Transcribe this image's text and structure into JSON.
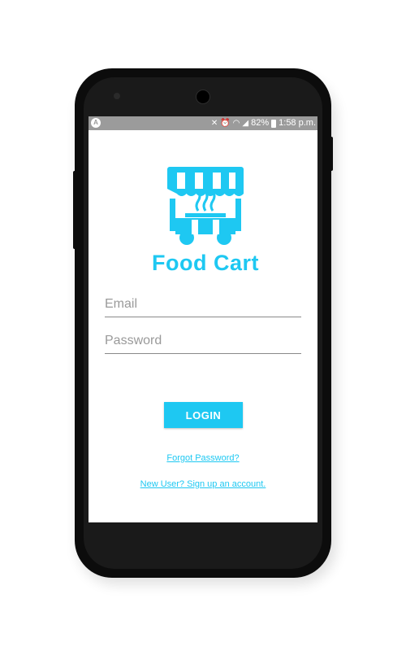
{
  "colors": {
    "accent": "#1ec8f2",
    "status_bar": "#9b9b9b",
    "phone": "#0c0c0c"
  },
  "statusbar": {
    "left_icon": "A",
    "right_icons": [
      "mute-icon",
      "alarm-icon",
      "wifi-icon",
      "signal-icon"
    ],
    "battery_percent": "82%",
    "time": "1:58 p.m."
  },
  "logo": {
    "text": "Food Cart",
    "icon": "food-cart-icon"
  },
  "form": {
    "email_placeholder": "Email",
    "password_placeholder": "Password",
    "login_label": "LOGIN",
    "forgot_label": "Forgot Password?",
    "signup_label": "New User? Sign up an account."
  }
}
